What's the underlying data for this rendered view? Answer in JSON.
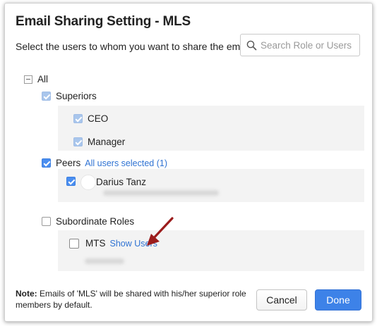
{
  "dialog": {
    "title": "Email Sharing Setting - MLS",
    "subtitle": "Select the users to whom you want to share the emails"
  },
  "search": {
    "placeholder": "Search Role or Users",
    "icon": "search-icon"
  },
  "tree": {
    "all_label": "All",
    "superiors": {
      "label": "Superiors",
      "state": "checked-disabled",
      "children": [
        {
          "label": "CEO"
        },
        {
          "label": "Manager"
        }
      ]
    },
    "peers": {
      "label": "Peers",
      "link": "All users selected (1)",
      "state": "checked",
      "users": [
        {
          "name": "Darius Tanz"
        }
      ]
    },
    "subordinates": {
      "label": "Subordinate Roles",
      "state": "unchecked",
      "children": [
        {
          "label": "MTS",
          "link": "Show Users"
        }
      ]
    }
  },
  "note": {
    "prefix": "Note:",
    "text": " Emails of 'MLS' will be shared with his/her superior role members by default."
  },
  "buttons": {
    "cancel": "Cancel",
    "done": "Done"
  },
  "colors": {
    "accent": "#3d82e8",
    "link": "#2f73d3",
    "arrow": "#9b1c1c"
  }
}
